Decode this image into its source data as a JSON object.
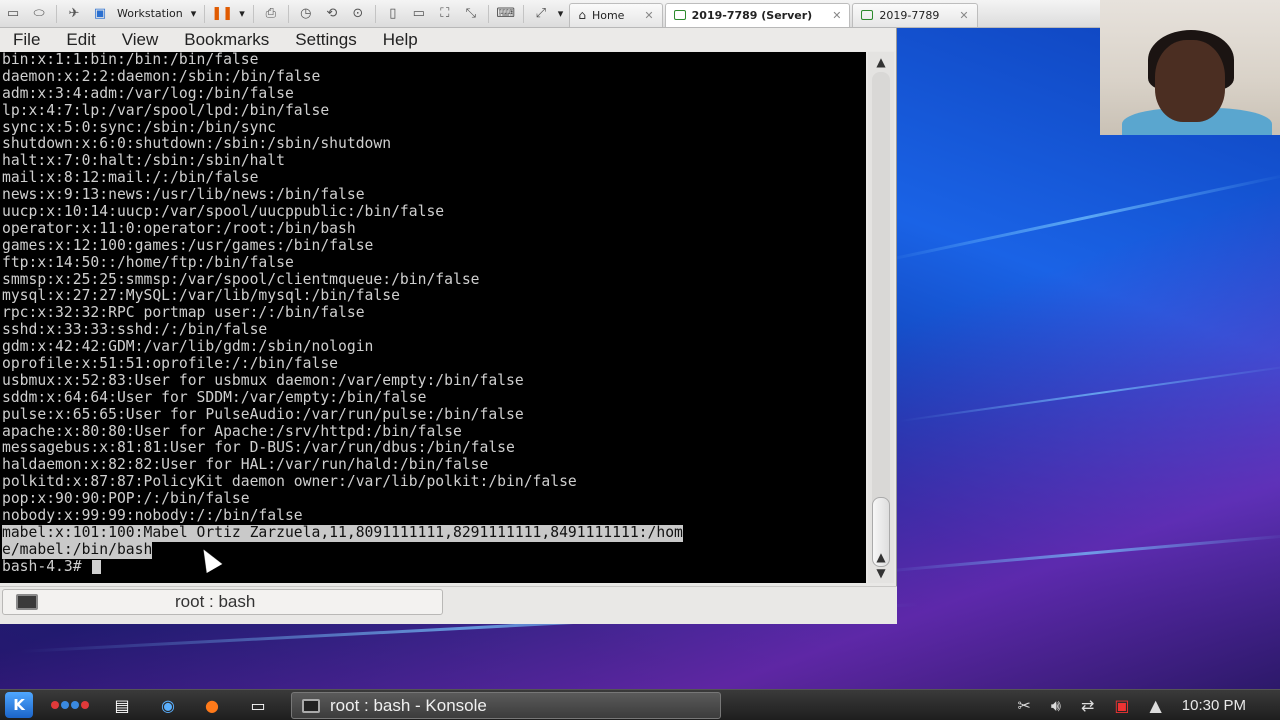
{
  "vm_toolbar": {
    "workstation_label": "Workstation",
    "tabs": [
      {
        "label": "Home"
      },
      {
        "label": "2019-7789 (Server)",
        "active": true
      },
      {
        "label": "2019-7789"
      }
    ]
  },
  "konsole": {
    "menu": [
      "File",
      "Edit",
      "View",
      "Bookmarks",
      "Settings",
      "Help"
    ],
    "lines": [
      "bin:x:1:1:bin:/bin:/bin/false",
      "daemon:x:2:2:daemon:/sbin:/bin/false",
      "adm:x:3:4:adm:/var/log:/bin/false",
      "lp:x:4:7:lp:/var/spool/lpd:/bin/false",
      "sync:x:5:0:sync:/sbin:/bin/sync",
      "shutdown:x:6:0:shutdown:/sbin:/sbin/shutdown",
      "halt:x:7:0:halt:/sbin:/sbin/halt",
      "mail:x:8:12:mail:/:/bin/false",
      "news:x:9:13:news:/usr/lib/news:/bin/false",
      "uucp:x:10:14:uucp:/var/spool/uucppublic:/bin/false",
      "operator:x:11:0:operator:/root:/bin/bash",
      "games:x:12:100:games:/usr/games:/bin/false",
      "ftp:x:14:50::/home/ftp:/bin/false",
      "smmsp:x:25:25:smmsp:/var/spool/clientmqueue:/bin/false",
      "mysql:x:27:27:MySQL:/var/lib/mysql:/bin/false",
      "rpc:x:32:32:RPC portmap user:/:/bin/false",
      "sshd:x:33:33:sshd:/:/bin/false",
      "gdm:x:42:42:GDM:/var/lib/gdm:/sbin/nologin",
      "oprofile:x:51:51:oprofile:/:/bin/false",
      "usbmux:x:52:83:User for usbmux daemon:/var/empty:/bin/false",
      "sddm:x:64:64:User for SDDM:/var/empty:/bin/false",
      "pulse:x:65:65:User for PulseAudio:/var/run/pulse:/bin/false",
      "apache:x:80:80:User for Apache:/srv/httpd:/bin/false",
      "messagebus:x:81:81:User for D-BUS:/var/run/dbus:/bin/false",
      "haldaemon:x:82:82:User for HAL:/var/run/hald:/bin/false",
      "polkitd:x:87:87:PolicyKit daemon owner:/var/lib/polkit:/bin/false",
      "pop:x:90:90:POP:/:/bin/false",
      "nobody:x:99:99:nobody:/:/bin/false"
    ],
    "selected_line_1": "mabel:x:101:100:Mabel Ortiz Zarzuela,11,8091111111,8291111111,8491111111:/hom",
    "selected_line_2": "e/mabel:/bin/bash",
    "prompt": "bash-4.3# ",
    "tab_label": "root : bash"
  },
  "taskbar": {
    "task_label": "root : bash - Konsole",
    "clock": "10:30 PM"
  }
}
